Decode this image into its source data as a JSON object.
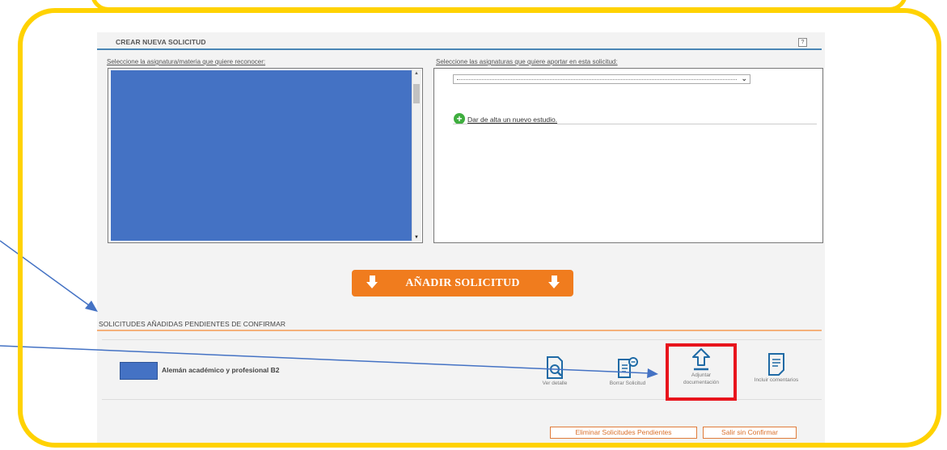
{
  "create_section": {
    "title": "CREAR NUEVA SOLICITUD",
    "help": "?",
    "left_label": "Seleccione la asignatura/materia que quiere reconocer:",
    "right_label": "Seleccione las asignaturas que quiere aportar en esta solicitud:",
    "add_study_link": "Dar de alta un nuevo estudio.",
    "add_study_icon": "+",
    "select_value": ""
  },
  "add_button": {
    "label": "AÑADIR SOLICITUD",
    "icon": "down-arrow-icon"
  },
  "pending_section": {
    "title": "SOLICITUDES AÑADIDAS PENDIENTES DE CONFIRMAR",
    "subject": "Alemán académico y profesional B2"
  },
  "actions": [
    {
      "label": "Ver detalle",
      "icon": "view-detail-icon"
    },
    {
      "label": "Borrar Solicitud",
      "icon": "delete-request-icon"
    },
    {
      "label": "Adjuntar documentación",
      "icon": "upload-icon"
    },
    {
      "label": "Incluir comentarios",
      "icon": "comment-icon"
    }
  ],
  "footer": {
    "delete_pending": "Eliminar Solicitudes Pendientes",
    "exit": "Salir sin Confirmar"
  },
  "colors": {
    "frame": "#FFD200",
    "accent_orange": "#F07C1E",
    "selection_blue": "#4472C4",
    "highlight_red": "#E8141C",
    "rule_blue": "#4a86b5"
  }
}
